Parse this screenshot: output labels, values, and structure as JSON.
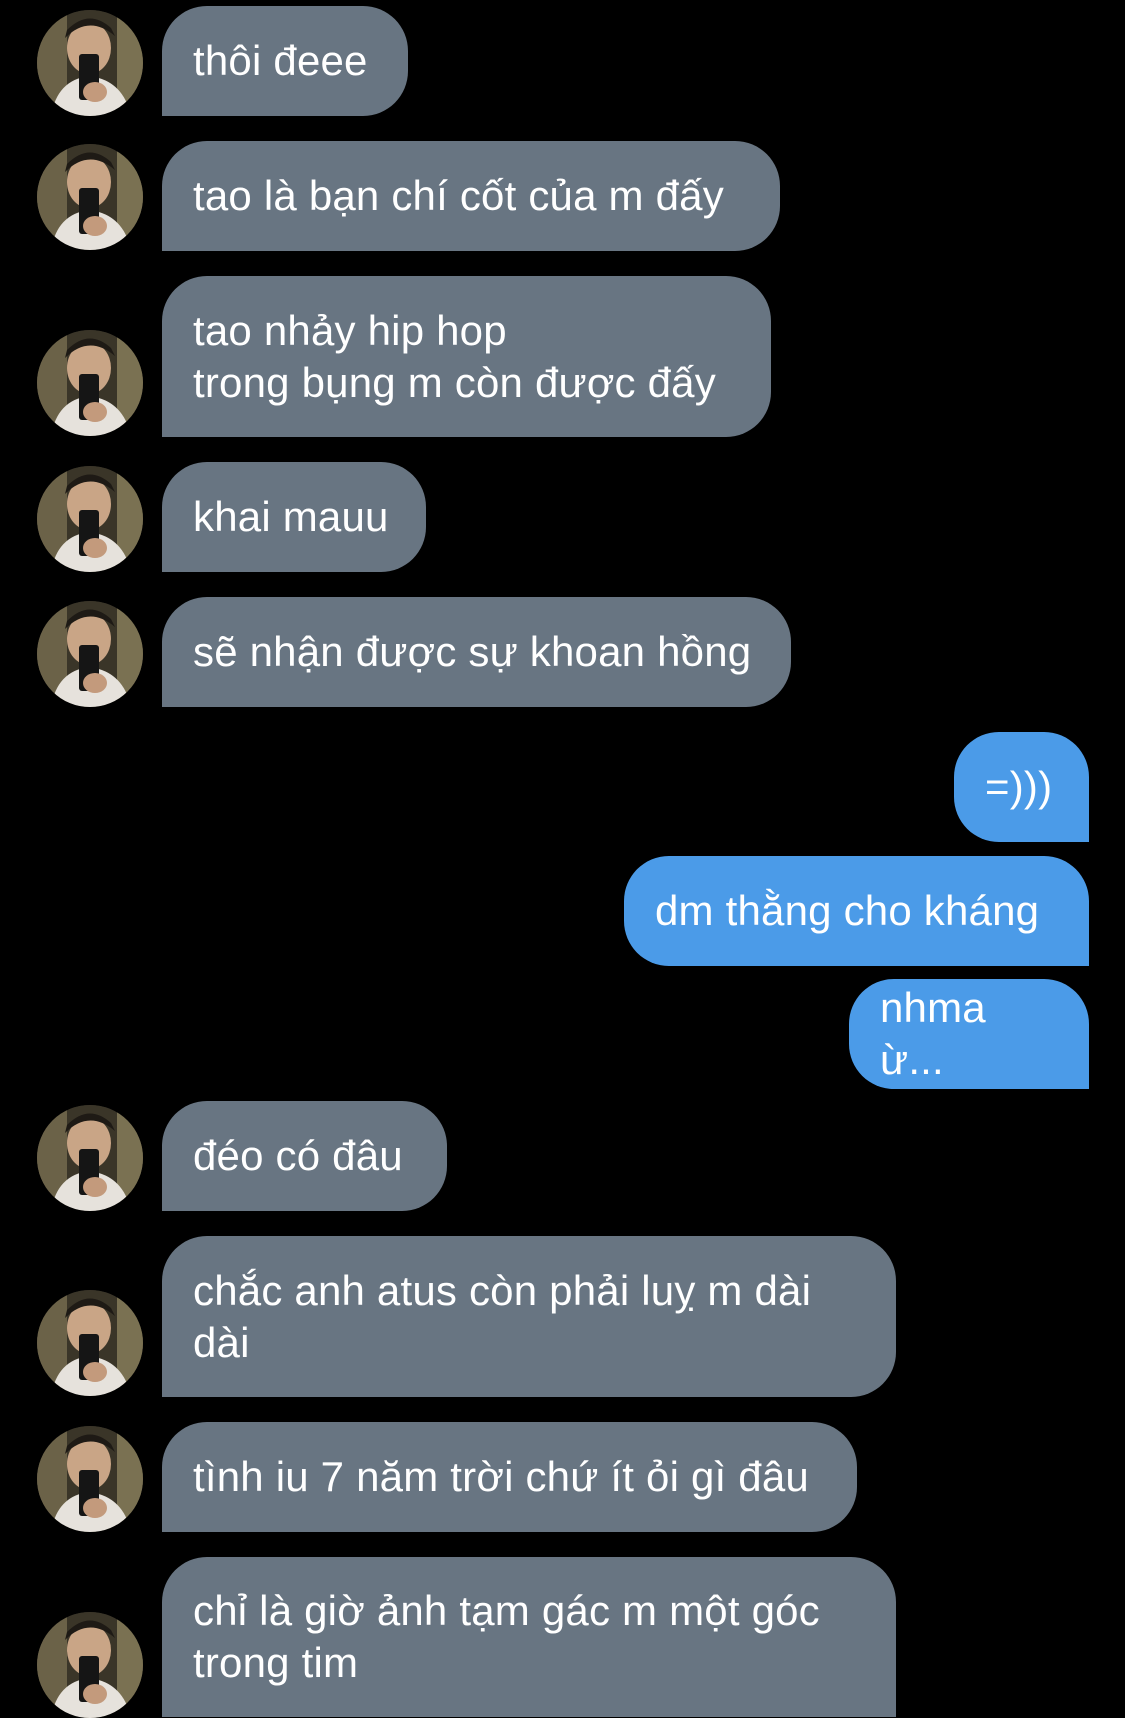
{
  "conversation": {
    "messages": [
      {
        "sender": "them",
        "text": "thôi đeee"
      },
      {
        "sender": "them",
        "text": "tao là bạn chí cốt của m đấy"
      },
      {
        "sender": "them",
        "text": "tao nhảy hip hop\ntrong bụng m còn được đấy"
      },
      {
        "sender": "them",
        "text": "khai mauu"
      },
      {
        "sender": "them",
        "text": "sẽ nhận được sự khoan hồng"
      },
      {
        "sender": "me",
        "text": "=)))"
      },
      {
        "sender": "me",
        "text": "dm thằng cho kháng"
      },
      {
        "sender": "me",
        "text": "nhma ừ..."
      },
      {
        "sender": "them",
        "text": "đéo có đâu"
      },
      {
        "sender": "them",
        "text": "chắc anh atus còn phải luỵ m dài\ndài"
      },
      {
        "sender": "them",
        "text": "tình iu 7 năm trời chứ ít ỏi gì đâu"
      },
      {
        "sender": "them",
        "text": "chỉ là giờ ảnh tạm gác m một góc\ntrong tim"
      }
    ]
  },
  "colors": {
    "background": "#000000",
    "incoming_bubble": "#687582",
    "outgoing_bubble": "#4b9be8",
    "text": "#ffffff"
  },
  "icons": {
    "avatar": "contact-avatar-photo"
  }
}
